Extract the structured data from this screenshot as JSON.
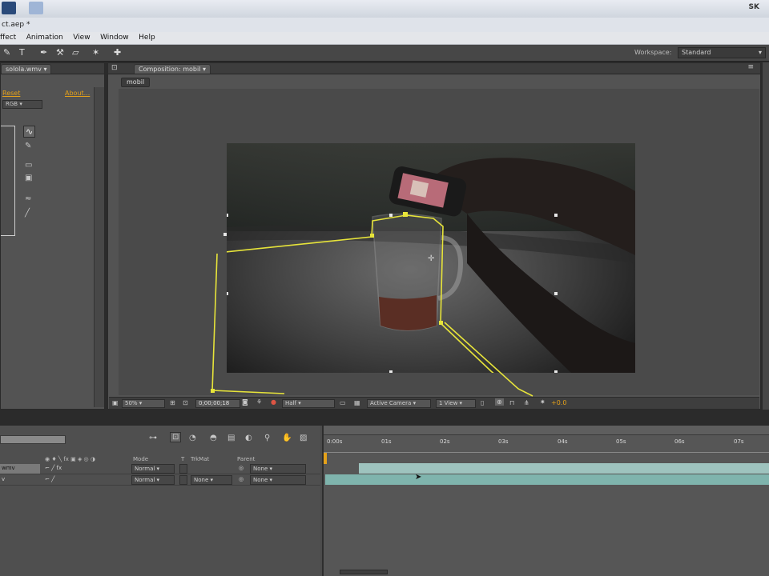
{
  "window": {
    "title": "ct.aep *",
    "corner_label": "SK"
  },
  "menu": [
    "ffect",
    "Animation",
    "View",
    "Window",
    "Help"
  ],
  "toolbar": {
    "tools": [
      "selection-tool-icon",
      "text-tool-icon",
      "pen-tool-icon",
      "clone-stamp-tool-icon",
      "eraser-tool-icon",
      "puppet-tool-icon",
      "pin-tool-icon"
    ],
    "workspace_label": "Workspace:",
    "workspace_value": "Standard"
  },
  "left_panel": {
    "tab_label": "solola.wmv",
    "reset_label": "Reset",
    "about_label": "About...",
    "channel_value": "RGB"
  },
  "comp_panel": {
    "tab_label": "Composition: mobil",
    "breadcrumb": "mobil",
    "zoom": "50%",
    "timecode": "0;00;00;18",
    "resolution": "Half",
    "camera": "Active Camera",
    "views": "1 View",
    "exposure": "+0.0"
  },
  "timeline": {
    "ruler": [
      "0:00s",
      "01s",
      "02s",
      "03s",
      "04s",
      "05s",
      "06s",
      "07s"
    ],
    "columns": {
      "mode": "Mode",
      "t": "T",
      "trkmat": "TrkMat",
      "parent": "Parent"
    },
    "layers": [
      {
        "name": "wmv",
        "mode": "Normal",
        "trkmat": "",
        "parent": "None"
      },
      {
        "name": "v",
        "mode": "Normal",
        "trkmat": "None",
        "parent": "None"
      }
    ]
  },
  "colors": {
    "accent": "#e4a11a",
    "mask": "#e7e43a",
    "layer_bar": "#7fb4ad"
  }
}
